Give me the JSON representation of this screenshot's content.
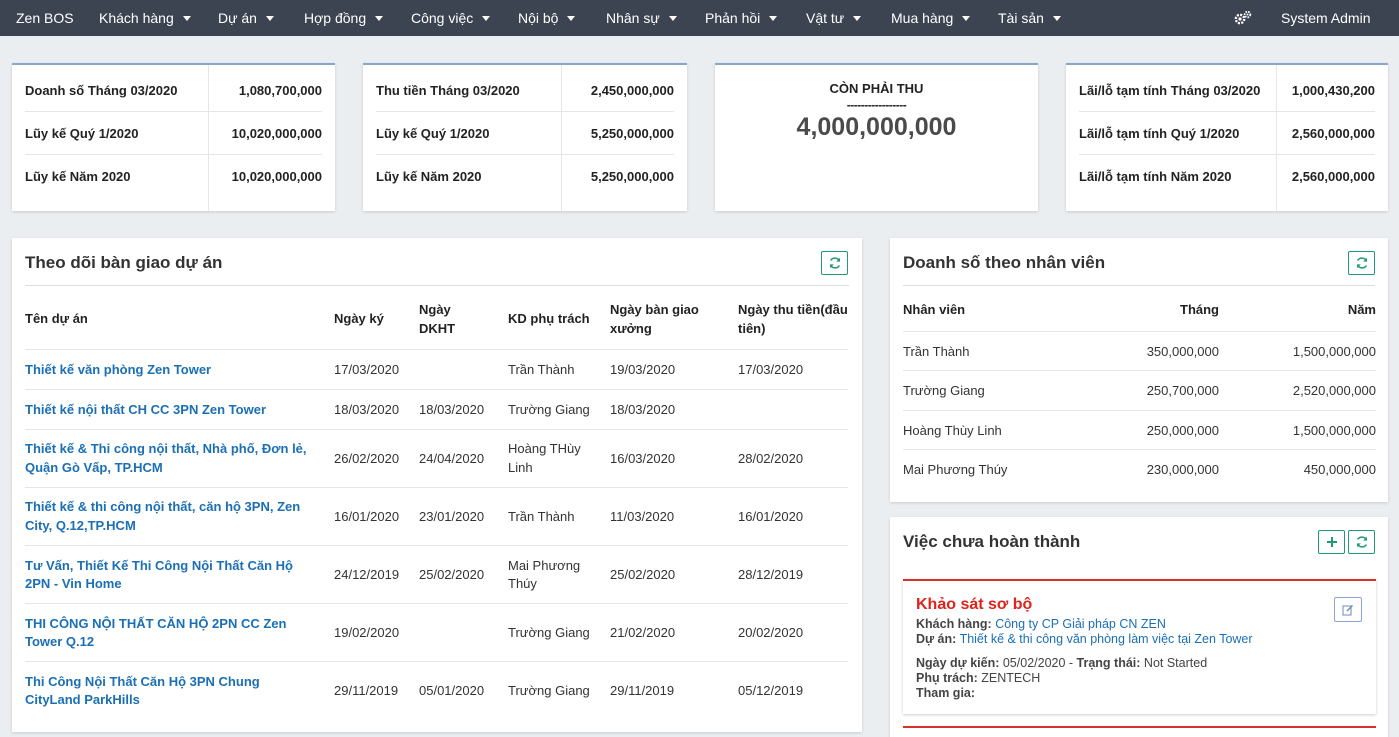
{
  "nav": {
    "brand": "Zen BOS",
    "items": [
      "Khách hàng",
      "Dự án",
      "Hợp đồng",
      "Công việc",
      "Nội bộ",
      "Nhân sự",
      "Phản hồi",
      "Vật tư",
      "Mua hàng",
      "Tài sản"
    ],
    "user": "System Admin"
  },
  "stats": {
    "sales": [
      {
        "label": "Doanh số Tháng 03/2020",
        "value": "1,080,700,000"
      },
      {
        "label": "Lũy kế Quý 1/2020",
        "value": "10,020,000,000"
      },
      {
        "label": "Lũy kế Năm 2020",
        "value": "10,020,000,000"
      }
    ],
    "collections": [
      {
        "label": "Thu tiền Tháng 03/2020",
        "value": "2,450,000,000"
      },
      {
        "label": "Lũy kế Quý 1/2020",
        "value": "5,250,000,000"
      },
      {
        "label": "Lũy kế Năm 2020",
        "value": "5,250,000,000"
      }
    ],
    "receivable": {
      "title": "CÒN PHẢI THU",
      "dash": "-----------------",
      "value": "4,000,000,000"
    },
    "profit": [
      {
        "label": "Lãi/lỗ tạm tính Tháng 03/2020",
        "value": "1,000,430,200"
      },
      {
        "label": "Lãi/lỗ tạm tính Quý 1/2020",
        "value": "2,560,000,000"
      },
      {
        "label": "Lãi/lỗ tạm tính Năm 2020",
        "value": "2,560,000,000"
      }
    ]
  },
  "projects": {
    "title": "Theo dõi bàn giao dự án",
    "headers": {
      "name": "Tên dự án",
      "signed": "Ngày ký",
      "dkht_1": "Ngày",
      "dkht_2": "DKHT",
      "kd": "KD phụ trách",
      "handover_1": "Ngày bàn giao",
      "handover_2": "xưởng",
      "collect_1": "Ngày thu tiền(đầu",
      "collect_2": "tiên)"
    },
    "rows": [
      {
        "name1": "Thiết kế văn phòng Zen Tower",
        "name2": "",
        "signed": "17/03/2020",
        "dkht": "",
        "kd1": "Trần Thành",
        "kd2": "",
        "handover": "19/03/2020",
        "collect": "17/03/2020"
      },
      {
        "name1": "Thiết kế nội thất CH CC 3PN Zen Tower",
        "name2": "",
        "signed": "18/03/2020",
        "dkht": "18/03/2020",
        "kd1": "Trường Giang",
        "kd2": "",
        "handover": "18/03/2020",
        "collect": ""
      },
      {
        "name1": "Thiết kế & Thi công nội thất, Nhà phố, Đơn lẻ,",
        "name2": "Quận Gò Vấp, TP.HCM",
        "signed": "26/02/2020",
        "dkht": "24/04/2020",
        "kd1": "Hoàng THùy",
        "kd2": "Linh",
        "handover": "16/03/2020",
        "collect": "28/02/2020"
      },
      {
        "name1": "Thiết kế & thi công nội thất, căn hộ 3PN, Zen",
        "name2": "City, Q.12,TP.HCM",
        "signed": "16/01/2020",
        "dkht": "23/01/2020",
        "kd1": "Trần Thành",
        "kd2": "",
        "handover": "11/03/2020",
        "collect": "16/01/2020"
      },
      {
        "name1": "Tư Vấn, Thiết Kế Thi Công Nội Thất Căn Hộ",
        "name2": "2PN - Vin Home",
        "signed": "24/12/2019",
        "dkht": "25/02/2020",
        "kd1": "Mai Phương",
        "kd2": "Thúy",
        "handover": "25/02/2020",
        "collect": "28/12/2019"
      },
      {
        "name1": "THI CÔNG NỘI THẤT CĂN HỘ 2PN CC Zen",
        "name2": "Tower Q.12",
        "signed": "19/02/2020",
        "dkht": "",
        "kd1": "Trường Giang",
        "kd2": "",
        "handover": "21/02/2020",
        "collect": "20/02/2020"
      },
      {
        "name1": "Thi Công Nội Thất Căn Hộ 3PN Chung",
        "name2": "CityLand ParkHills",
        "signed": "29/11/2019",
        "dkht": "05/01/2020",
        "kd1": "Trường Giang",
        "kd2": "",
        "handover": "29/11/2019",
        "collect": "05/12/2019"
      }
    ]
  },
  "sales_by_staff": {
    "title": "Doanh số theo nhân viên",
    "headers": {
      "staff": "Nhân viên",
      "month": "Tháng",
      "year": "Năm"
    },
    "rows": [
      {
        "name": "Trần Thành",
        "month": "350,000,000",
        "year": "1,500,000,000"
      },
      {
        "name": "Trường Giang",
        "month": "250,700,000",
        "year": "2,520,000,000"
      },
      {
        "name": "Hoàng Thùy Linh",
        "month": "250,000,000",
        "year": "1,500,000,000"
      },
      {
        "name": "Mai Phương Thúy",
        "month": "230,000,000",
        "year": "450,000,000"
      }
    ]
  },
  "tasks": {
    "title": "Việc chưa hoàn thành",
    "card": {
      "title": "Khảo sát sơ bộ",
      "customer_label": "Khách hàng:",
      "customer": "Công ty CP Giải pháp CN ZEN",
      "project_label": "Dự án:",
      "project": "Thiết kế & thi công văn phòng làm việc tại Zen Tower",
      "due_label": "Ngày dự kiến:",
      "due": "05/02/2020",
      "sep": " - ",
      "status_label": "Trạng thái:",
      "status": "Not Started",
      "owner_label": "Phụ trách:",
      "owner": "ZENTECH",
      "join_label": "Tham gia:"
    }
  },
  "colors": {
    "nav_bg": "#3c4452",
    "link": "#1a6fb5",
    "accent_green": "#1f9b6d",
    "task_red": "#e0221c"
  }
}
